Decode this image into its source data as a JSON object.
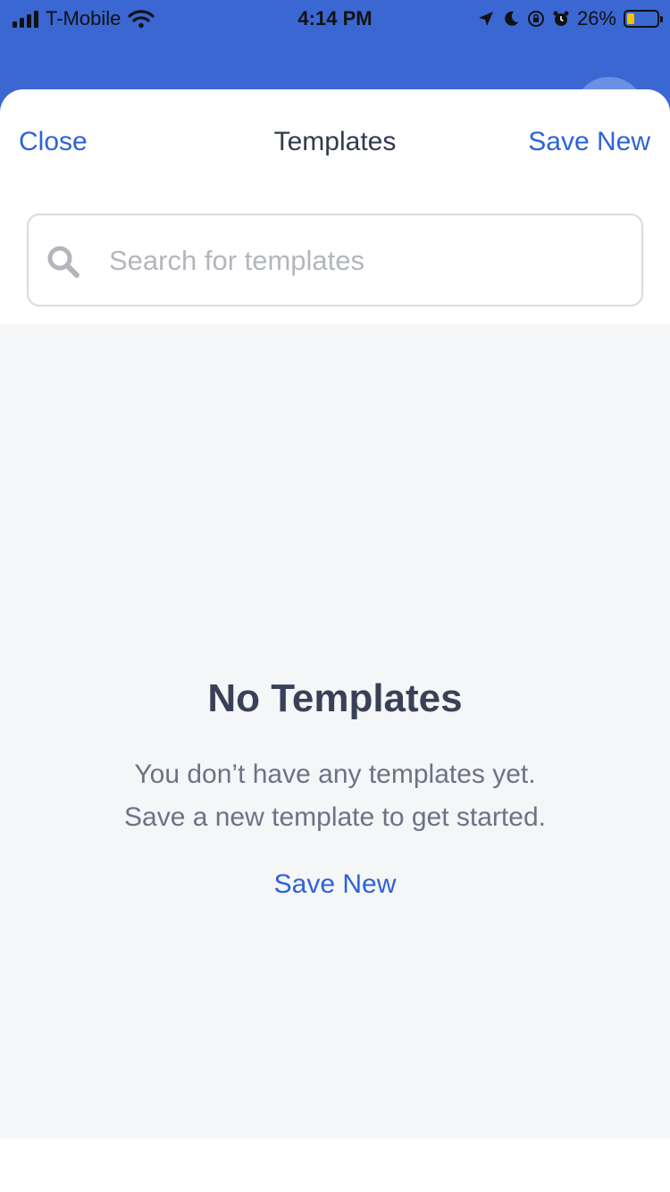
{
  "status_bar": {
    "carrier": "T-Mobile",
    "time": "4:14 PM",
    "battery_percent": "26%",
    "battery_level": 0.26,
    "battery_color": "#f5c400",
    "icons": [
      "signal-icon",
      "wifi-icon",
      "location-icon",
      "moon-icon",
      "rotation-lock-icon",
      "alarm-icon",
      "battery-icon"
    ]
  },
  "nav": {
    "close_label": "Close",
    "title": "Templates",
    "save_label": "Save New"
  },
  "search": {
    "placeholder": "Search for templates",
    "value": ""
  },
  "empty_state": {
    "title": "No Templates",
    "line1": "You don’t have any templates yet.",
    "line2": "Save a new template to get started.",
    "action_label": "Save New"
  },
  "colors": {
    "header_blue": "#3b67d3",
    "accent": "#2d63d8",
    "content_bg": "#f5f6f8"
  }
}
